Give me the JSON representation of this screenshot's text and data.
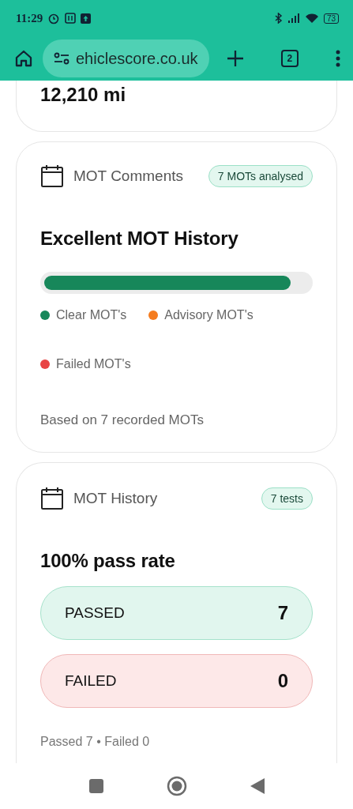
{
  "status_bar": {
    "time": "11:29",
    "battery": "73"
  },
  "browser": {
    "url": "ehiclescore.co.uk",
    "tab_count": "2"
  },
  "mileage_card": {
    "value": "12,210 mi"
  },
  "comments_card": {
    "title": "MOT Comments",
    "badge": "7 MOTs analysed",
    "heading": "Excellent MOT History",
    "bar": {
      "level": 0.93
    },
    "legend": [
      {
        "label": "Clear MOT's",
        "color": "#17875a"
      },
      {
        "label": "Advisory MOT's",
        "color": "#f57c1f"
      },
      {
        "label": "Failed MOT's",
        "color": "#e84545"
      }
    ],
    "footnote": "Based on 7 recorded MOTs"
  },
  "history_card": {
    "title": "MOT History",
    "badge": "7 tests",
    "heading": "100% pass rate",
    "rows": [
      {
        "kind": "pass",
        "label": "PASSED",
        "count": "7"
      },
      {
        "kind": "fail",
        "label": "FAILED",
        "count": "0"
      }
    ],
    "summary": "Passed 7 • Failed 0"
  }
}
